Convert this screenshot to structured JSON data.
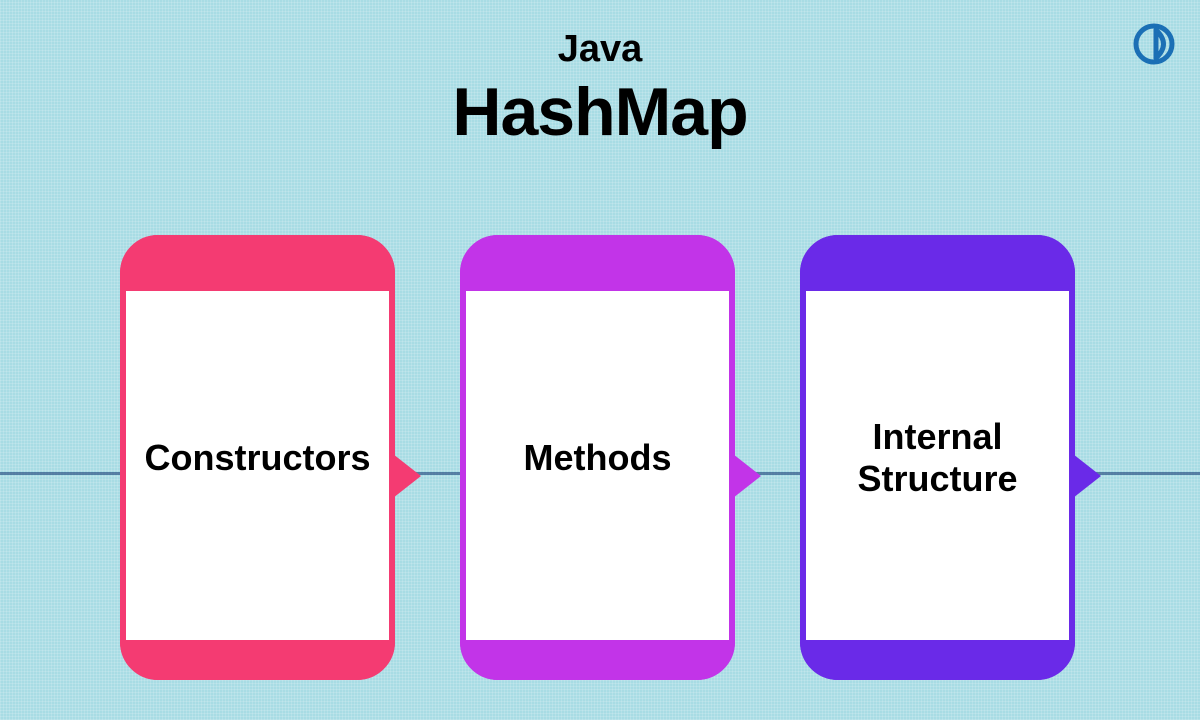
{
  "header": {
    "subtitle": "Java",
    "title": "HashMap"
  },
  "cards": [
    {
      "label": "Constructors",
      "color": "#f43b72"
    },
    {
      "label": "Methods",
      "color": "#c234e8"
    },
    {
      "label": "Internal Structure",
      "color": "#6a2ae8"
    }
  ]
}
